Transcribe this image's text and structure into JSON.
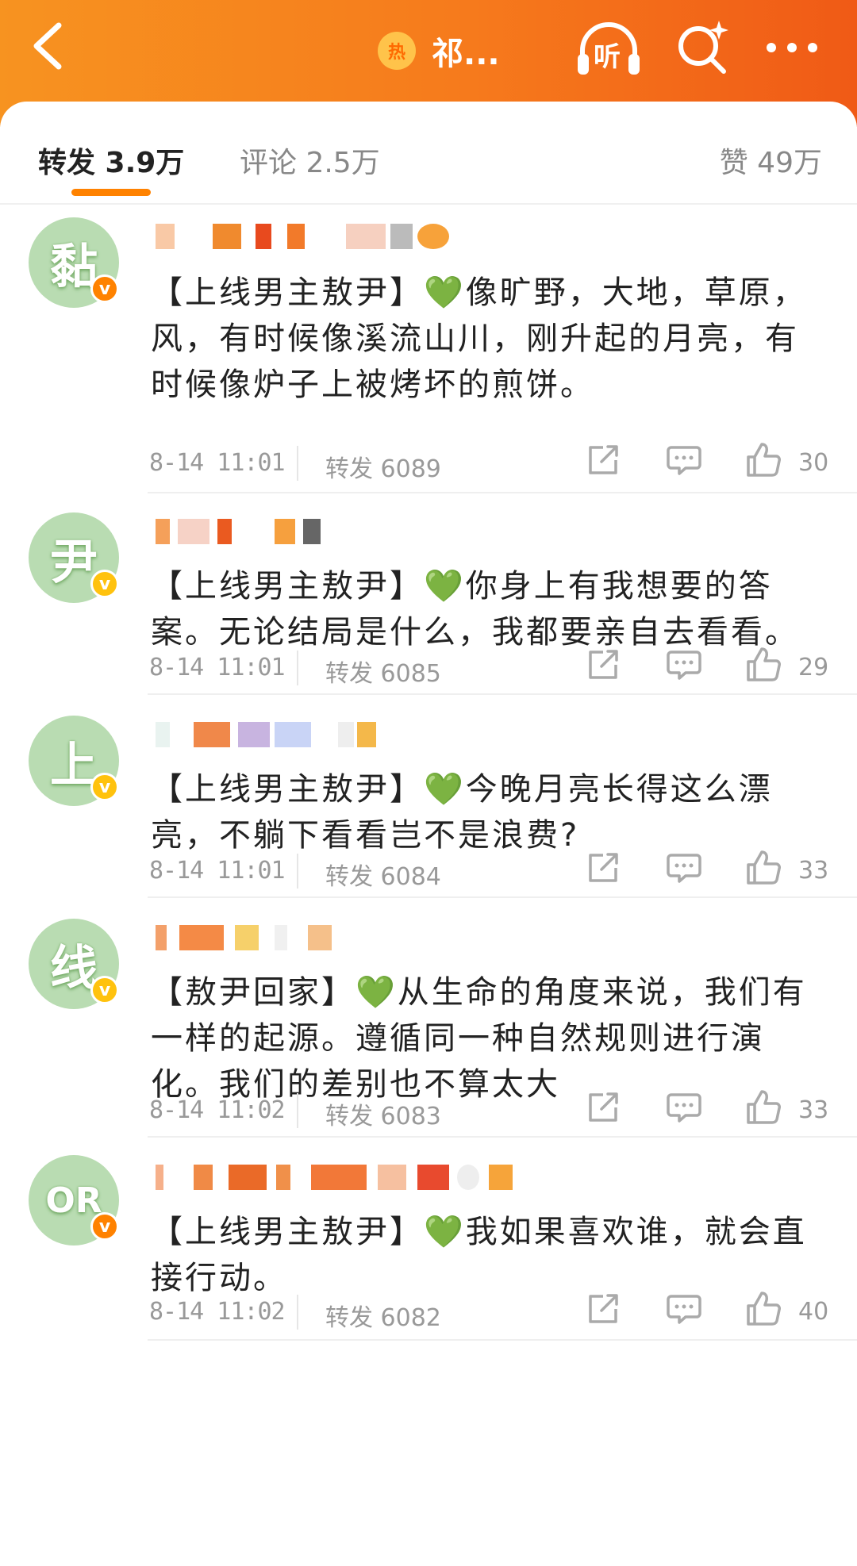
{
  "header": {
    "back_icon": "chevron-left-icon",
    "hot_badge": "热",
    "topic": "祁...",
    "listen_label": "听",
    "search_icon": "search-sparkle-icon",
    "more_icon": "ellipsis-icon"
  },
  "tabs": {
    "repost": "转发 3.9万",
    "comment": "评论 2.5万",
    "like": "赞 49万"
  },
  "colors": {
    "header_orange": "#f67a1c",
    "accent": "#ff8200",
    "verified_gold": "#ffc20e",
    "avatar_green": "#b9dcb2"
  },
  "posts": [
    {
      "avatar_text": "黏",
      "badge": "v",
      "content": "【上线男主敖尹】💚像旷野，大地，草原，风，有时候像溪流山川，刚升起的月亮，有时候像炉子上被烤坏的煎饼。",
      "time": "8-14 11:01",
      "repost": "转发 6089",
      "likes": "30"
    },
    {
      "avatar_text": "尹",
      "badge": "v",
      "content": "【上线男主敖尹】💚你身上有我想要的答案。无论结局是什么，我都要亲自去看看。",
      "time": "8-14 11:01",
      "repost": "转发 6085",
      "likes": "29"
    },
    {
      "avatar_text": "上",
      "badge": "v",
      "content": "【上线男主敖尹】💚今晚月亮长得这么漂亮，不躺下看看岂不是浪费?",
      "time": "8-14 11:01",
      "repost": "转发 6084",
      "likes": "33"
    },
    {
      "avatar_text": "线",
      "badge": "v",
      "content": "【敖尹回家】💚从生命的角度来说，我们有一样的起源。遵循同一种自然规则进行演化。我们的差别也不算太大",
      "time": "8-14 11:02",
      "repost": "转发 6083",
      "likes": "33"
    },
    {
      "avatar_text": "OR",
      "badge": "v",
      "content": "【上线男主敖尹】💚我如果喜欢谁，就会直接行动。",
      "time": "8-14 11:02",
      "repost": "转发 6082",
      "likes": "40"
    }
  ]
}
